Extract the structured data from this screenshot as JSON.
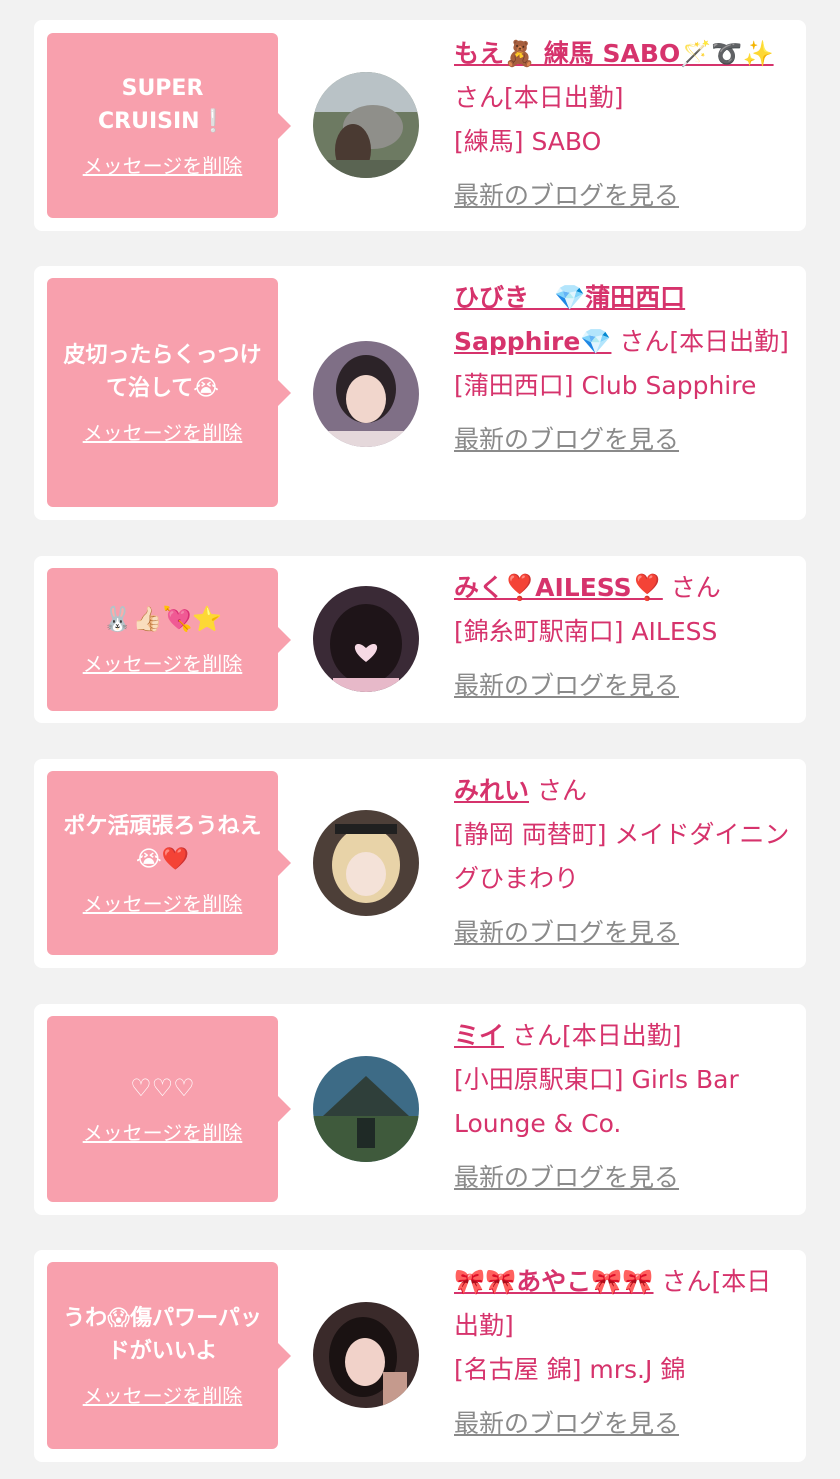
{
  "delete_label": "メッセージを削除",
  "blog_label": "最新のブログを見る",
  "items": [
    {
      "message": "SUPER CRUISIN❕",
      "name": "もえ🧸 練馬 SABO🪄➰✨",
      "suffix": "さん[本日出勤]",
      "shop": "[練馬] SABO",
      "avatar_icon": "avatar-photo-outdoor"
    },
    {
      "message": "皮切ったらくっつけて治して😭",
      "name": "ひびき　💎蒲田西口Sapphire💎",
      "suffix": "さん[本日出勤]",
      "shop": "[蒲田西口] Club Sapphire",
      "avatar_icon": "avatar-photo-portrait"
    },
    {
      "message": "🐰👍🏻💘⭐",
      "name": "みく❣️AILESS❣️",
      "suffix": "さん",
      "shop": "[錦糸町駅南口] AILESS",
      "avatar_icon": "avatar-photo-heart"
    },
    {
      "message": "ポケ活頑張ろうねえ😭❤️",
      "name": "みれい",
      "suffix": "さん",
      "shop": "[静岡 両替町] メイドダイニングひまわり",
      "avatar_icon": "avatar-photo-maid"
    },
    {
      "message": "♡♡♡",
      "name": "ミイ",
      "suffix": "さん[本日出勤]",
      "shop": "[小田原駅東口] Girls Bar Lounge & Co.",
      "avatar_icon": "avatar-photo-park"
    },
    {
      "message": "うわ😱傷パワーパッドがいいよ",
      "name": "🎀🎀あやこ🎀🎀",
      "suffix": "さん[本日出勤]",
      "shop": "[名古屋 錦] mrs.J 錦",
      "avatar_icon": "avatar-photo-selfie"
    }
  ]
}
